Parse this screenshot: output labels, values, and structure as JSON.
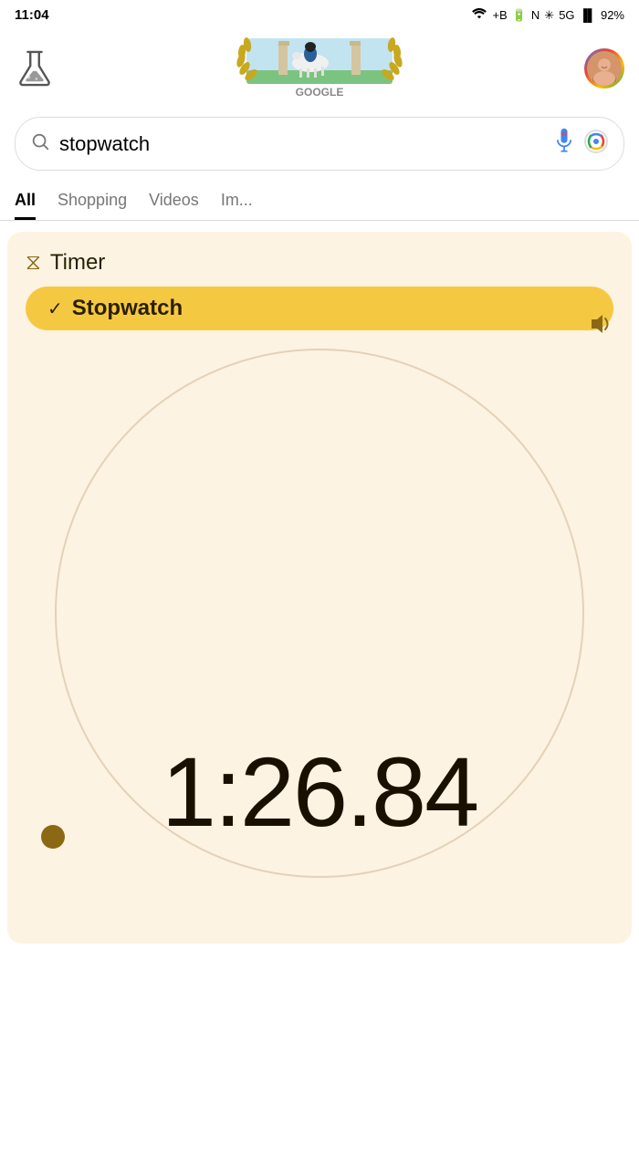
{
  "statusBar": {
    "time": "11:04",
    "wifi": "wifi",
    "carrier": "+B",
    "batteryIcon": "battery",
    "nfc": "N",
    "bluetooth": "bluetooth",
    "fiveG": "5G",
    "signal": "signal",
    "battery": "92%"
  },
  "header": {
    "labIconAlt": "lab flask",
    "doodleAlt": "Google Doodle",
    "profileAlt": "User profile"
  },
  "searchBar": {
    "query": "stopwatch",
    "placeholder": "Search",
    "micLabel": "Voice search",
    "lensLabel": "Google Lens"
  },
  "tabs": [
    {
      "label": "All",
      "active": true
    },
    {
      "label": "Shopping",
      "active": false
    },
    {
      "label": "Videos",
      "active": false
    },
    {
      "label": "Im...",
      "active": false
    }
  ],
  "widget": {
    "timerLabel": "Timer",
    "timerIconUnicode": "⧗",
    "stopwatchLabel": "Stopwatch",
    "checkmark": "✓",
    "soundIconLabel": "sound",
    "timeDisplay": "1:26.84",
    "dotLabel": "progress dot"
  }
}
